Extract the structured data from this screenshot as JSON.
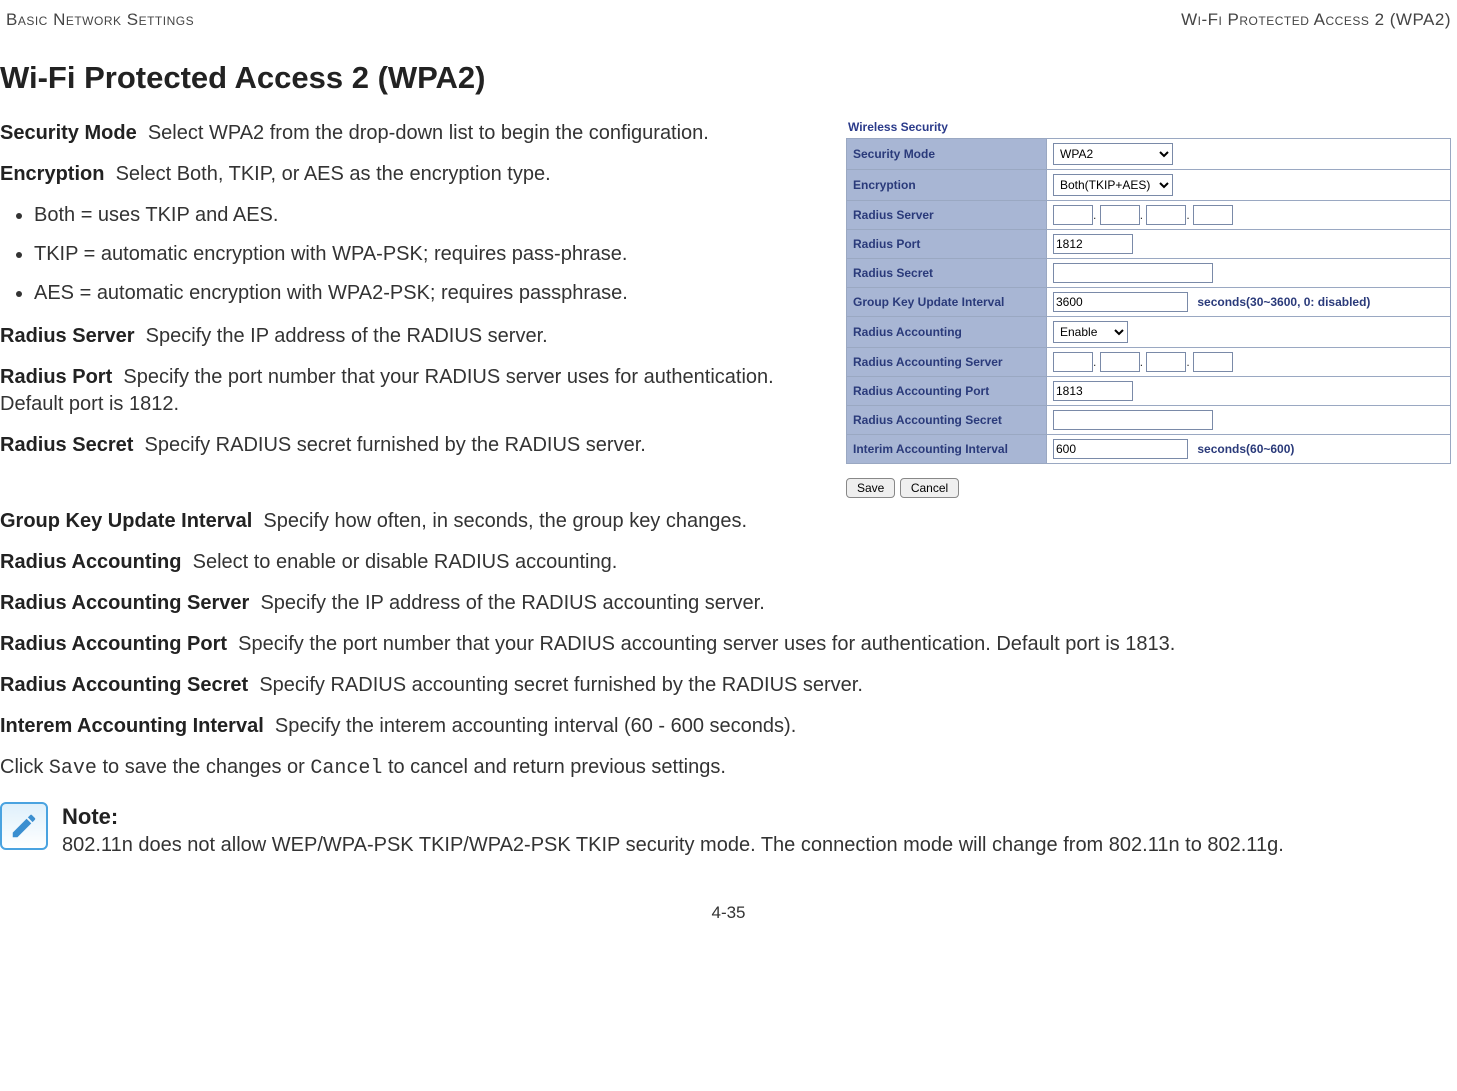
{
  "header": {
    "left": "Basic Network Settings",
    "right": "Wi-Fi Protected Access 2 (WPA2)"
  },
  "title": "Wi-Fi Protected Access 2 (WPA2)",
  "panel": {
    "title": "Wireless Security",
    "rows": {
      "security_mode": {
        "label": "Security Mode",
        "value": "WPA2"
      },
      "encryption": {
        "label": "Encryption",
        "value": "Both(TKIP+AES)"
      },
      "radius_server": {
        "label": "Radius Server"
      },
      "radius_port": {
        "label": "Radius Port",
        "value": "1812"
      },
      "radius_secret": {
        "label": "Radius Secret",
        "value": ""
      },
      "group_key": {
        "label": "Group Key Update Interval",
        "value": "3600",
        "unit": "seconds(30~3600, 0: disabled)"
      },
      "radius_accounting": {
        "label": "Radius Accounting",
        "value": "Enable"
      },
      "radius_acct_server": {
        "label": "Radius Accounting Server"
      },
      "radius_acct_port": {
        "label": "Radius Accounting Port",
        "value": "1813"
      },
      "radius_acct_secret": {
        "label": "Radius Accounting Secret",
        "value": ""
      },
      "interim_interval": {
        "label": "Interim Accounting Interval",
        "value": "600",
        "unit": "seconds(60~600)"
      }
    },
    "buttons": {
      "save": "Save",
      "cancel": "Cancel"
    },
    "dot": "."
  },
  "defs": {
    "security_mode": {
      "term": "Security Mode",
      "text": "Select WPA2 from the drop-down list to begin the configuration."
    },
    "encryption": {
      "term": "Encryption",
      "text": "Select Both, TKIP, or AES as the encryption type."
    },
    "bullets": {
      "both": "Both = uses TKIP and AES.",
      "tkip": "TKIP = automatic encryption with WPA-PSK; requires pass-phrase.",
      "aes": "AES = automatic encryption with WPA2-PSK; requires passphrase."
    },
    "radius_server": {
      "term": "Radius Server",
      "text": "Specify the IP address of the RADIUS server."
    },
    "radius_port": {
      "term": "Radius Port",
      "text": "Specify the port number that your RADIUS server uses for authentication. Default port is 1812."
    },
    "radius_secret": {
      "term": "Radius Secret",
      "text": "Specify RADIUS secret furnished by the RADIUS server."
    },
    "group_key": {
      "term": "Group Key Update Interval",
      "text": "Specify how often, in seconds, the group key changes."
    },
    "radius_accounting": {
      "term": "Radius Accounting",
      "text": "Select to enable or disable RADIUS accounting."
    },
    "radius_acct_server": {
      "term": "Radius Accounting Server",
      "text": "Specify the IP address of the RADIUS accounting server."
    },
    "radius_acct_port": {
      "term": "Radius Accounting Port",
      "text": "Specify the port number that your RADIUS accounting server uses for authentication. Default port is 1813."
    },
    "radius_acct_secret": {
      "term": "Radius Accounting Secret",
      "text": "Specify RADIUS accounting secret furnished by the RADIUS server."
    },
    "interim_interval": {
      "term": "Interem Accounting Interval",
      "text": "Specify the interem accounting interval (60 - 600 seconds)."
    }
  },
  "save_line": {
    "pre": "Click ",
    "save": "Save",
    "mid": " to save the changes or ",
    "cancel": "Cancel",
    "post": " to cancel and return previous settings."
  },
  "note": {
    "title": "Note:",
    "body": "802.11n does not allow WEP/WPA-PSK TKIP/WPA2-PSK TKIP security mode. The connection mode will change from 802.11n to 802.11g."
  },
  "footer": "4-35"
}
